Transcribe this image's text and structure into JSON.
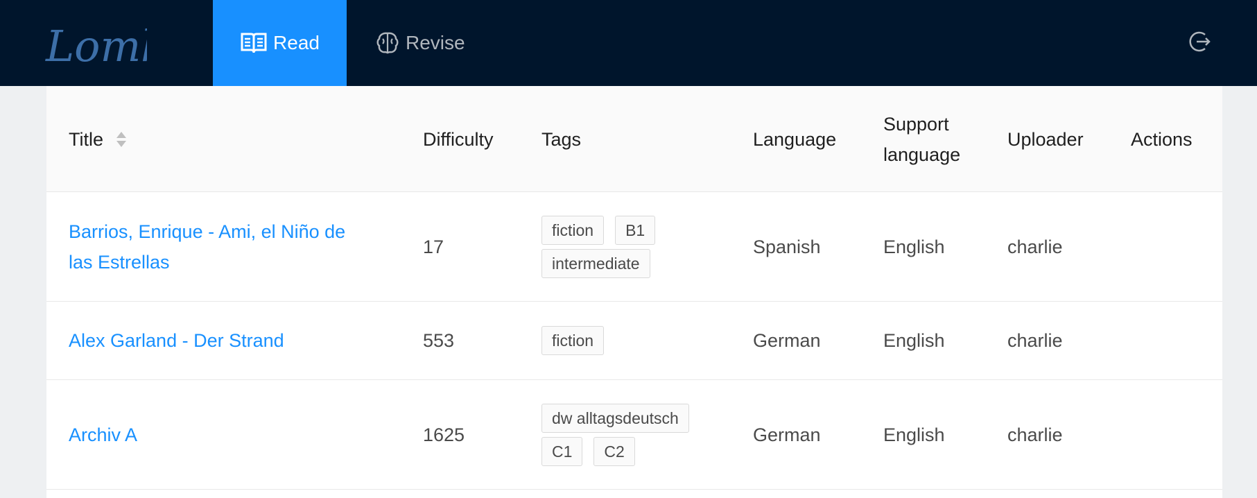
{
  "nav": {
    "logo_text": "Lomb",
    "items": [
      {
        "label": "Read",
        "icon": "book-open-icon",
        "active": true
      },
      {
        "label": "Revise",
        "icon": "brain-icon",
        "active": false
      }
    ],
    "logout_icon": "logout-icon"
  },
  "colors": {
    "nav_bg": "#00152c",
    "active_tab": "#1890ff",
    "link": "#1890ff"
  },
  "table": {
    "columns": {
      "title": "Title",
      "difficulty": "Difficulty",
      "tags": "Tags",
      "language": "Language",
      "support_language": "Support language",
      "uploader": "Uploader",
      "actions": "Actions"
    },
    "rows": [
      {
        "title": "Barrios, Enrique - Ami, el Niño de las Estrellas",
        "difficulty": "17",
        "tags": [
          "fiction",
          "B1",
          "intermediate"
        ],
        "language": "Spanish",
        "support_language": "English",
        "uploader": "charlie"
      },
      {
        "title": "Alex Garland - Der Strand",
        "difficulty": "553",
        "tags": [
          "fiction"
        ],
        "language": "German",
        "support_language": "English",
        "uploader": "charlie"
      },
      {
        "title": "Archiv A",
        "difficulty": "1625",
        "tags": [
          "dw alltagsdeutsch",
          "C1",
          "C2"
        ],
        "language": "German",
        "support_language": "English",
        "uploader": "charlie"
      }
    ]
  }
}
